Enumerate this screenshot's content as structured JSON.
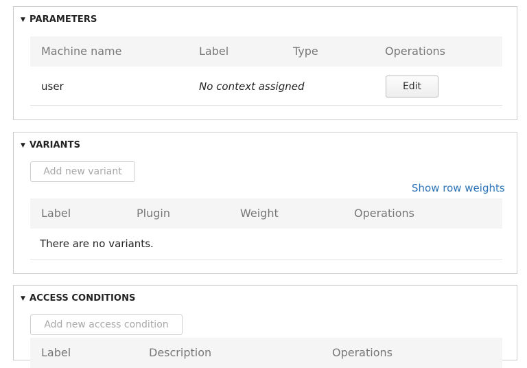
{
  "parameters": {
    "title": "PARAMETERS",
    "columns": [
      "Machine name",
      "Label",
      "Type",
      "Operations"
    ],
    "rows": [
      {
        "machine_name": "user",
        "label": "No context assigned",
        "type": "",
        "operation": "Edit"
      }
    ]
  },
  "variants": {
    "title": "VARIANTS",
    "add_button": "Add new variant",
    "show_weights_link": "Show row weights",
    "columns": [
      "Label",
      "Plugin",
      "Weight",
      "Operations"
    ],
    "empty_message": "There are no variants."
  },
  "access_conditions": {
    "title": "ACCESS CONDITIONS",
    "add_button": "Add new access condition",
    "columns": [
      "Label",
      "Description",
      "Operations"
    ]
  },
  "colors": {
    "link": "#2b74b8",
    "header_bg": "#f5f5f5",
    "border": "#cccccc"
  },
  "icons": {
    "expanded_marker": "triangle-down"
  }
}
